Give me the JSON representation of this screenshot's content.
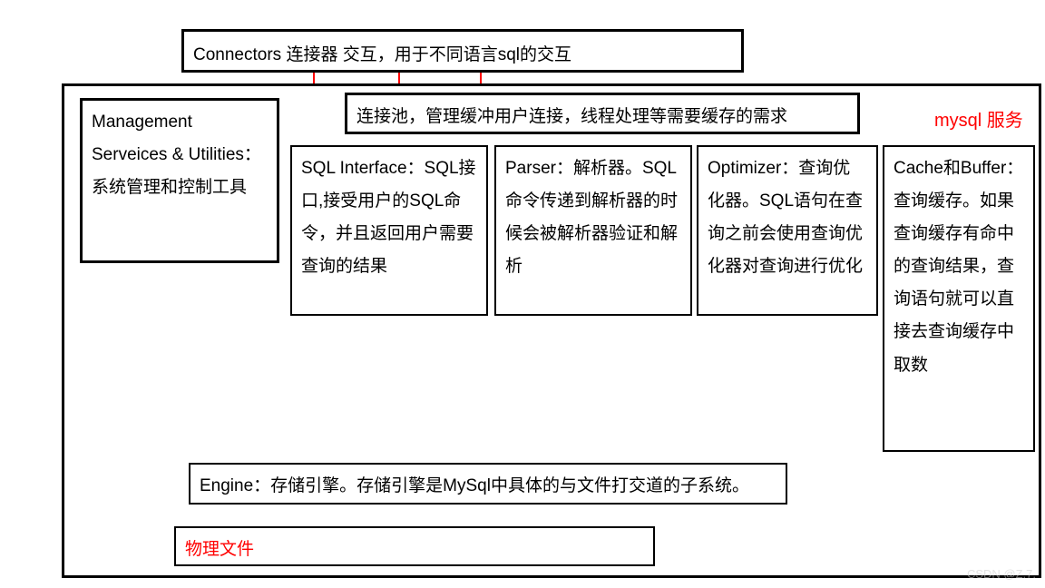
{
  "connectors": "Connectors 连接器 交互，用于不同语言sql的交互",
  "service_label": "mysql 服务",
  "management": "Management Serveices & Utilities：系统管理和控制工具",
  "connection_pool": "连接池，管理缓冲用户连接，线程处理等需要缓存的需求",
  "sql_interface": "SQL Interface：SQL接口,接受用户的SQL命令，并且返回用户需要查询的结果",
  "parser": "Parser：解析器。SQL命令传递到解析器的时候会被解析器验证和解析",
  "optimizer": "Optimizer：查询优化器。SQL语句在查询之前会使用查询优化器对查询进行优化",
  "cache": "Cache和Buffer：查询缓存。如果查询缓存有命中的查询结果，查询语句就可以直接去查询缓存中取数",
  "engine": "Engine：存储引擎。存储引擎是MySql中具体的与文件打交道的子系统。",
  "physical_file": "物理文件",
  "watermark": "CSDN @Z.7."
}
